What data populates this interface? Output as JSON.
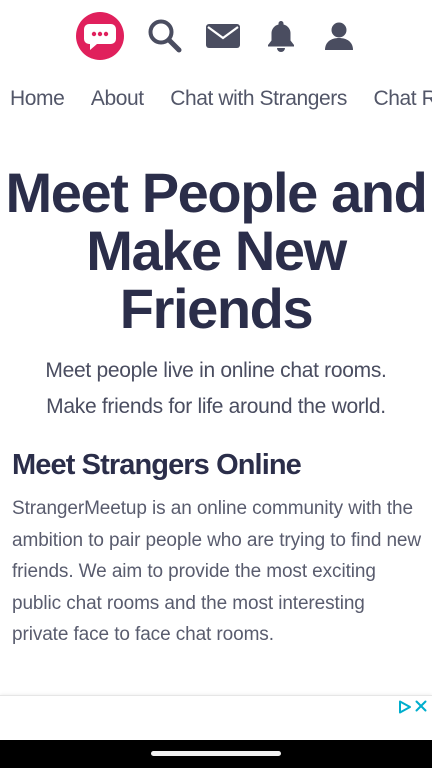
{
  "header": {
    "icons": [
      "chat-logo-icon",
      "search-icon",
      "mail-icon",
      "bell-icon",
      "user-icon"
    ],
    "colors": {
      "logo": "#e0205c",
      "icon": "#4a4d60"
    }
  },
  "nav": {
    "items": [
      {
        "label": "Home"
      },
      {
        "label": "About"
      },
      {
        "label": "Chat with Strangers"
      },
      {
        "label": "Chat Rooms"
      }
    ]
  },
  "hero": {
    "title_lines": [
      "Meet People and",
      "Make New",
      "Friends"
    ],
    "subtitle_lines": [
      "Meet people live in online chat rooms.",
      "Make friends for life around the world."
    ]
  },
  "section": {
    "title": "Meet Strangers Online",
    "body": "StrangerMeetup is an online community with the ambition to pair people who are trying to find new friends. We aim to provide the most exciting public chat rooms and the most interesting private face to face chat rooms."
  },
  "ad": {
    "icons": [
      "ad-choices-icon",
      "close-icon"
    ],
    "accent": "#00aecd"
  }
}
